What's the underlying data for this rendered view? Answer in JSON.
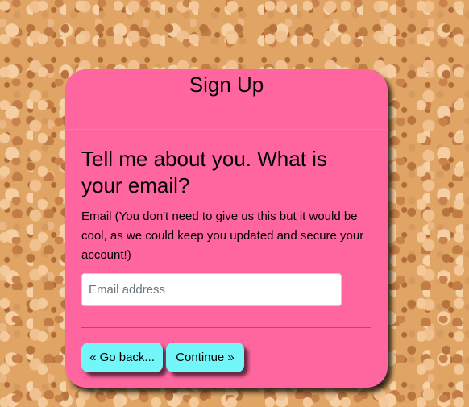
{
  "signup": {
    "title": "Sign Up",
    "question": "Tell me about you. What is your email?",
    "email_label": "Email (You don't need to give us this but it would be cool, as we could keep you updated and secure your account!)",
    "email_placeholder": "Email address",
    "email_value": "",
    "back_label": "« Go back...",
    "continue_label": "Continue »"
  },
  "colors": {
    "card_background": "#ff659f",
    "button_background": "#72f6f8",
    "page_background": "#e0a565"
  }
}
